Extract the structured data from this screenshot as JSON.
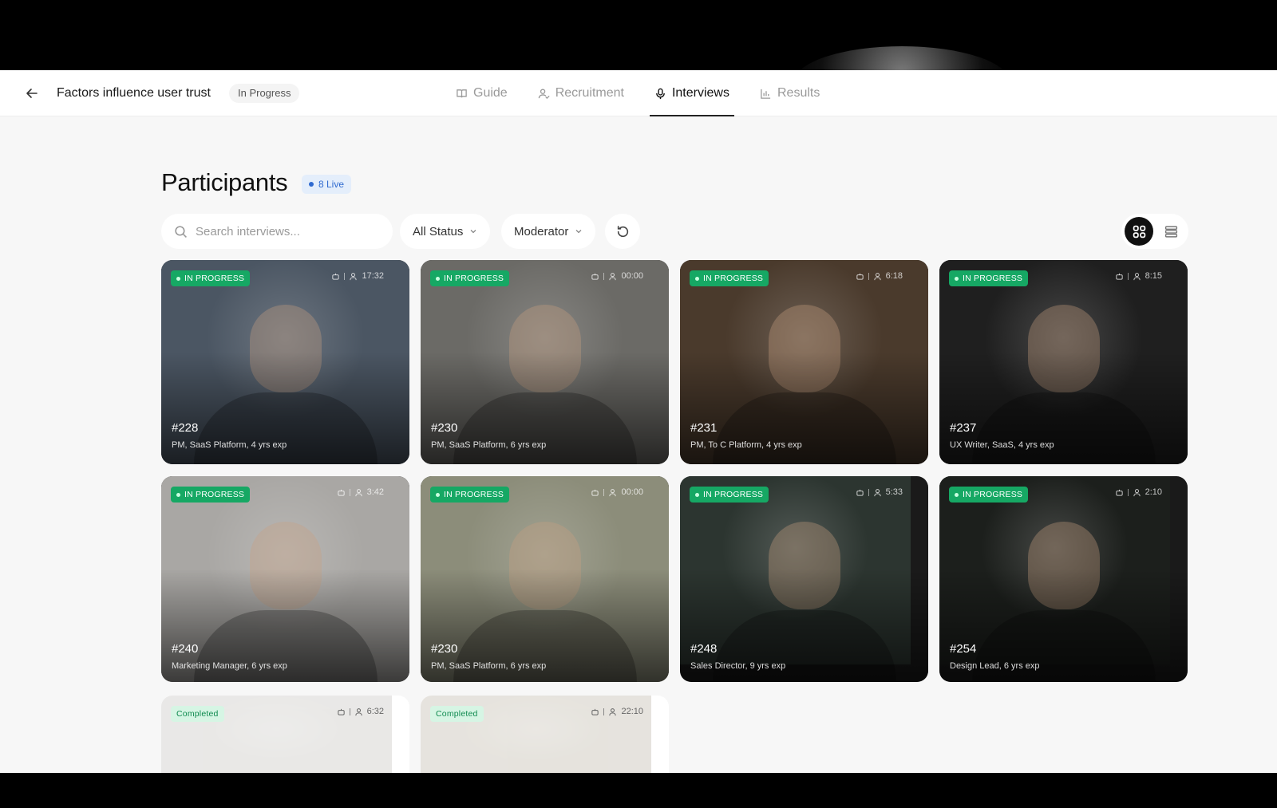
{
  "header": {
    "project_title": "Factors influence user trust",
    "project_status": "In Progress",
    "tabs": [
      {
        "label": "Guide",
        "icon": "book-icon"
      },
      {
        "label": "Recruitment",
        "icon": "user-check-icon"
      },
      {
        "label": "Interviews",
        "icon": "microphone-icon",
        "active": true
      },
      {
        "label": "Results",
        "icon": "bar-chart-icon"
      }
    ]
  },
  "participants": {
    "title": "Participants",
    "live_badge": "8 Live",
    "search_placeholder": "Search interviews...",
    "status_filter": "All Status",
    "moderator_filter": "Moderator",
    "view_mode": "grid"
  },
  "cards": [
    {
      "status": "IN PROGRESS",
      "time": "17:32",
      "id": "#228",
      "desc": "PM, SaaS Platform, 4 yrs exp",
      "bg": "#4b5663"
    },
    {
      "status": "IN PROGRESS",
      "time": "00:00",
      "id": "#230",
      "desc": "PM, SaaS Platform, 6 yrs exp",
      "bg": "#6b6a66"
    },
    {
      "status": "IN PROGRESS",
      "time": "6:18",
      "id": "#231",
      "desc": "PM, To C Platform, 4 yrs exp",
      "bg": "#4a3a2c"
    },
    {
      "status": "IN PROGRESS",
      "time": "8:15",
      "id": "#237",
      "desc": "UX Writer, SaaS, 4 yrs exp",
      "bg": "#1f1f1f"
    },
    {
      "status": "IN PROGRESS",
      "time": "3:42",
      "id": "#240",
      "desc": "Marketing Manager, 6 yrs exp",
      "bg": "#a9a7a4"
    },
    {
      "status": "IN PROGRESS",
      "time": "00:00",
      "id": "#230",
      "desc": "PM, SaaS Platform, 6 yrs exp",
      "bg": "#8c8d7a"
    },
    {
      "status": "IN PROGRESS",
      "time": "5:33",
      "id": "#248",
      "desc": "Sales Director, 9 yrs exp",
      "bg": "#2c3530"
    },
    {
      "status": "IN PROGRESS",
      "time": "2:10",
      "id": "#254",
      "desc": "Design Lead, 6 yrs exp",
      "bg": "#1c1f1c"
    },
    {
      "status": "Completed",
      "time": "6:32",
      "id": "",
      "desc": "",
      "bg": "#cfcdc9"
    },
    {
      "status": "Completed",
      "time": "22:10",
      "id": "",
      "desc": "",
      "bg": "#c8c2b5"
    }
  ],
  "colors": {
    "in_progress": "#16a864",
    "completed_bg": "#d6f5e4",
    "live_badge": "#2f6ad0"
  }
}
